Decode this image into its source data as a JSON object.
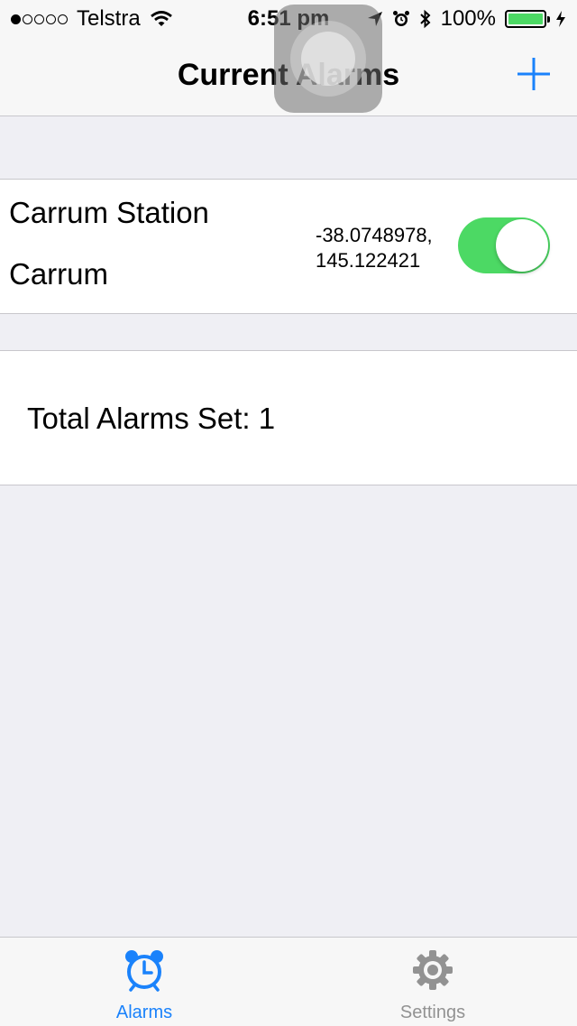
{
  "status_bar": {
    "carrier": "Telstra",
    "signal_strength": 1,
    "signal_max": 5,
    "time": "6:51 pm",
    "battery": "100%",
    "icons": [
      "wifi-icon",
      "location-arrow-icon",
      "alarm-clock-icon",
      "bluetooth-icon",
      "charging-bolt-icon"
    ]
  },
  "nav": {
    "title": "Current Alarms",
    "add_icon": "plus-icon"
  },
  "alarm": {
    "title": "Carrum Station",
    "subtitle": "Carrum",
    "latitude": "-38.0748978,",
    "longitude": "145.122421",
    "enabled": true
  },
  "summary": {
    "total_label": "Total Alarms Set: 1"
  },
  "tabs": [
    {
      "label": "Alarms",
      "icon": "alarm-clock-icon",
      "selected": true
    },
    {
      "label": "Settings",
      "icon": "gear-icon",
      "selected": false
    }
  ],
  "colors": {
    "accent": "#1a82fb",
    "toggle_on": "#4cd964",
    "background": "#efeff4",
    "inactive_tab": "#929292"
  }
}
